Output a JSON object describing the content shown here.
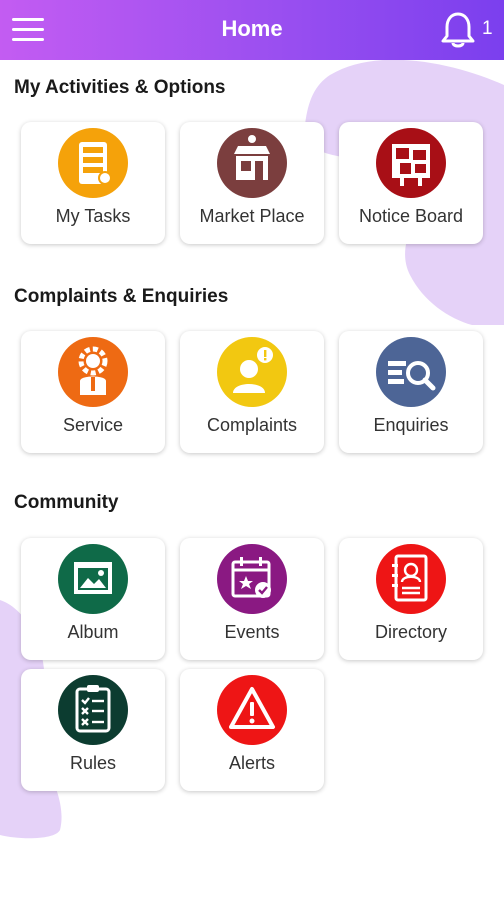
{
  "header": {
    "title": "Home",
    "notification_count": "1"
  },
  "sections": [
    {
      "title": "My Activities & Options",
      "items": [
        {
          "label": "My Tasks",
          "icon": "tasks-icon",
          "color": "#f5a20a"
        },
        {
          "label": "Market Place",
          "icon": "store-icon",
          "color": "#7b3e3e"
        },
        {
          "label": "Notice Board",
          "icon": "notice-board-icon",
          "color": "#a80f16"
        }
      ]
    },
    {
      "title": "Complaints & Enquiries",
      "items": [
        {
          "label": "Service",
          "icon": "service-icon",
          "color": "#ee6a13"
        },
        {
          "label": "Complaints",
          "icon": "complaints-icon",
          "color": "#f2c811"
        },
        {
          "label": "Enquiries",
          "icon": "enquiries-icon",
          "color": "#4d6596"
        }
      ]
    },
    {
      "title": "Community",
      "items": [
        {
          "label": "Album",
          "icon": "album-icon",
          "color": "#0f6a48"
        },
        {
          "label": "Events",
          "icon": "events-icon",
          "color": "#8a1982"
        },
        {
          "label": "Directory",
          "icon": "directory-icon",
          "color": "#ee1515"
        },
        {
          "label": "Rules",
          "icon": "rules-icon",
          "color": "#0c3c30"
        },
        {
          "label": "Alerts",
          "icon": "alerts-icon",
          "color": "#ee1515"
        }
      ]
    }
  ]
}
